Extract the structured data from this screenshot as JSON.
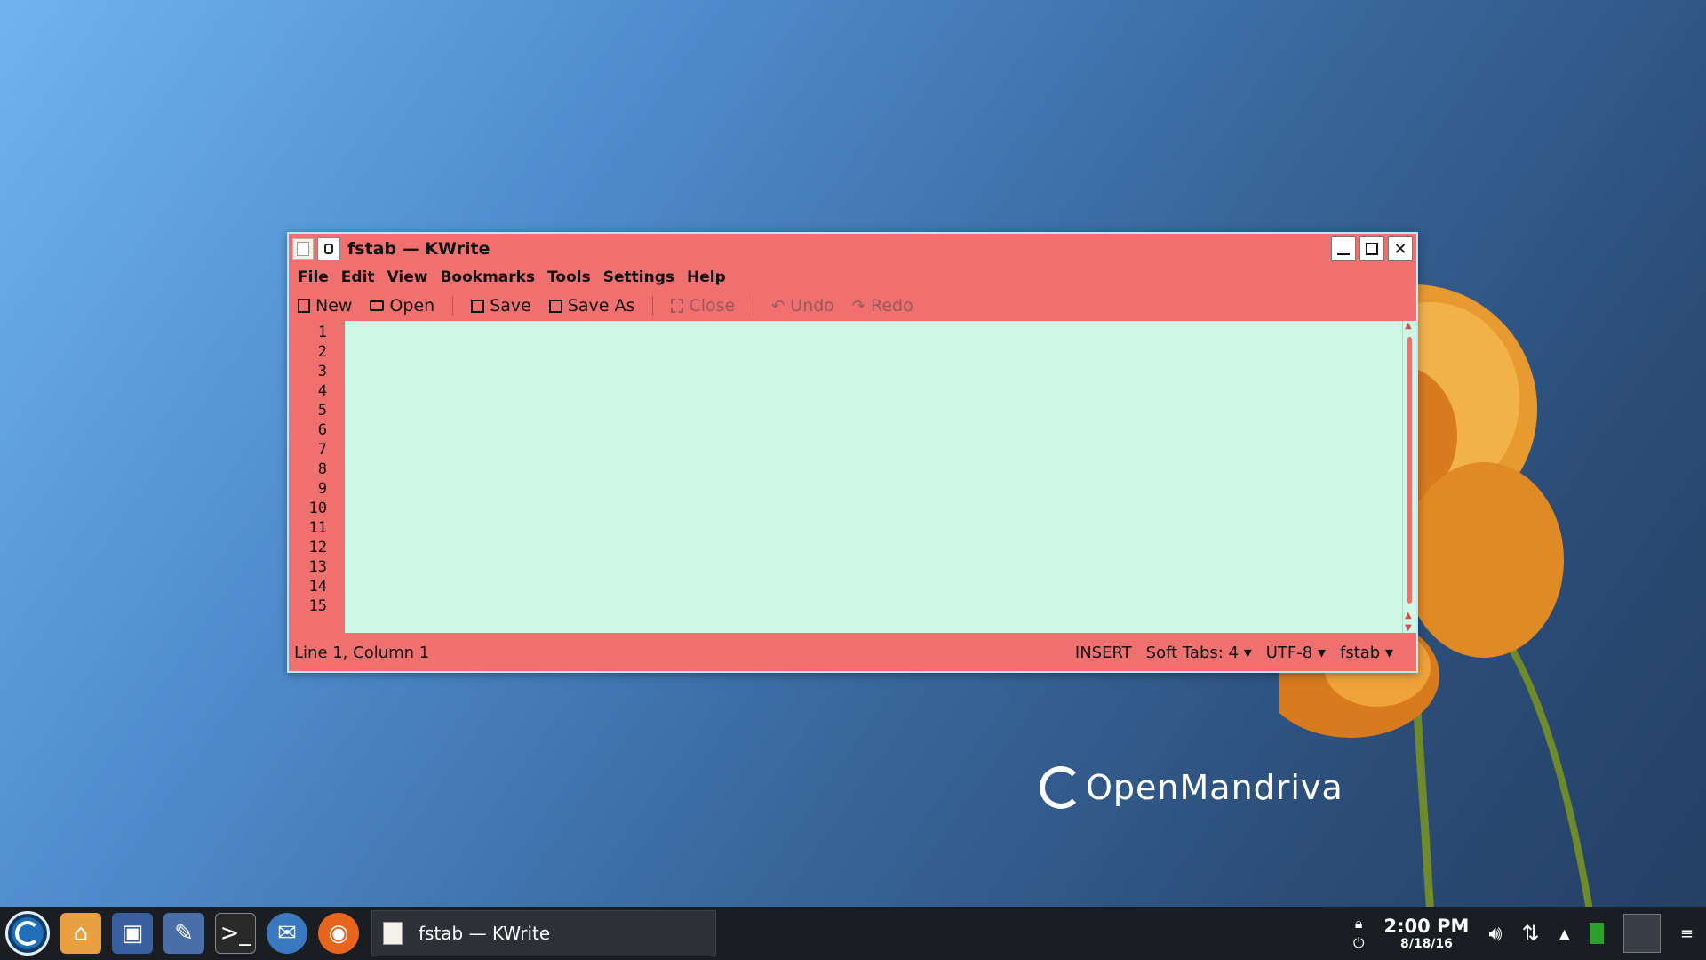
{
  "window": {
    "title": "fstab — KWrite"
  },
  "menu": [
    "File",
    "Edit",
    "View",
    "Bookmarks",
    "Tools",
    "Settings",
    "Help"
  ],
  "toolbar": {
    "new": "New",
    "open": "Open",
    "save": "Save",
    "save_as": "Save As",
    "close": "Close",
    "undo": "Undo",
    "redo": "Redo"
  },
  "editor": {
    "line_numbers": [
      "1",
      "2",
      "3",
      "4",
      "5",
      "6",
      "7",
      "8",
      "9",
      "10",
      "11",
      "12",
      "13",
      "14",
      "15"
    ]
  },
  "status": {
    "position": "Line 1, Column 1",
    "mode": "INSERT",
    "tabs": "Soft Tabs: 4",
    "encoding": "UTF-8",
    "syntax": "fstab"
  },
  "taskbar": {
    "task_label": "fstab — KWrite",
    "time": "2:00 PM",
    "date": "8/18/16"
  },
  "wallpaper": {
    "brand": "OpenMandriva"
  },
  "colors": {
    "window_bg": "#f07070",
    "editor_bg": "#cef8e6",
    "comment": "#7c5a33",
    "path": "#d33a66",
    "type": "#2b6fd6"
  }
}
